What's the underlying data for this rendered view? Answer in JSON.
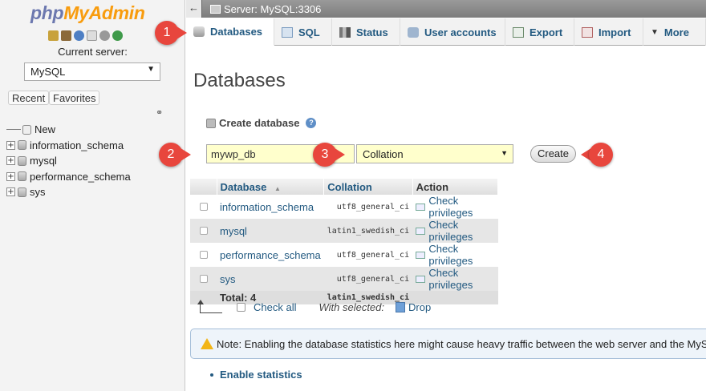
{
  "colors": {
    "accent_link": "#235a81",
    "callout": "#e8463d",
    "input_bg": "#ffffcc",
    "logo_php": "#6c78af",
    "logo_admin": "#f89c0e"
  },
  "sidebar": {
    "logo_php": "php",
    "logo_admin": "MyAdmin",
    "icons": [
      "home-icon",
      "exit-icon",
      "help-icon",
      "docs-icon",
      "settings-icon",
      "reload-icon"
    ],
    "current_server_label": "Current server:",
    "server_value": "MySQL",
    "tab_recent": "Recent",
    "tab_favorites": "Favorites",
    "tree": [
      {
        "label": "New",
        "kind": "new"
      },
      {
        "label": "information_schema",
        "kind": "db"
      },
      {
        "label": "mysql",
        "kind": "db"
      },
      {
        "label": "performance_schema",
        "kind": "db"
      },
      {
        "label": "sys",
        "kind": "db"
      }
    ]
  },
  "topbar": {
    "collapse": "←",
    "server": "Server: MySQL:3306"
  },
  "tabs": [
    {
      "label": "Databases",
      "icon": "database-icon",
      "active": true
    },
    {
      "label": "SQL",
      "icon": "sql-icon"
    },
    {
      "label": "Status",
      "icon": "status-icon"
    },
    {
      "label": "User accounts",
      "icon": "users-icon"
    },
    {
      "label": "Export",
      "icon": "export-icon"
    },
    {
      "label": "Import",
      "icon": "import-icon"
    },
    {
      "label": "More",
      "icon": "more-icon"
    }
  ],
  "main": {
    "title": "Databases",
    "create_label": "Create database",
    "dbname_value": "mywp_db",
    "collation_value": "Collation",
    "create_button": "Create",
    "table": {
      "headers": {
        "database": "Database",
        "sort": "▲",
        "collation": "Collation",
        "action": "Action"
      },
      "rows": [
        {
          "name": "information_schema",
          "collation": "utf8_general_ci",
          "action": "Check privileges"
        },
        {
          "name": "mysql",
          "collation": "latin1_swedish_ci",
          "action": "Check privileges"
        },
        {
          "name": "performance_schema",
          "collation": "utf8_general_ci",
          "action": "Check privileges"
        },
        {
          "name": "sys",
          "collation": "utf8_general_ci",
          "action": "Check privileges"
        }
      ],
      "total_label": "Total: 4",
      "total_collation": "latin1_swedish_ci"
    },
    "check_all": "Check all",
    "with_selected": "With selected:",
    "drop": "Drop",
    "note": "Note: Enabling the database statistics here might cause heavy traffic between the web server and the MySQL",
    "enable_stats": "Enable statistics"
  },
  "callouts": [
    "1",
    "2",
    "3",
    "4"
  ]
}
